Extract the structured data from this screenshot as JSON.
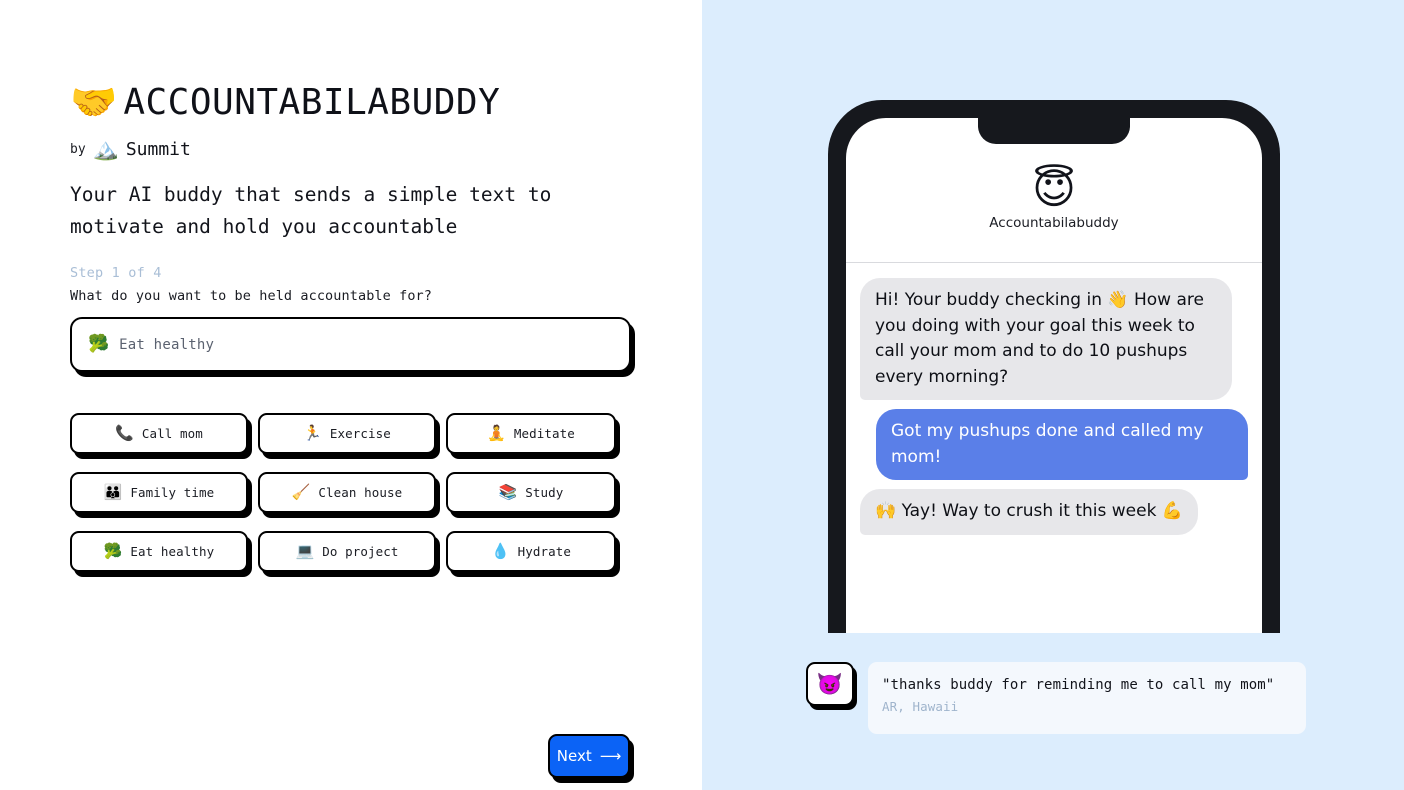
{
  "brand": {
    "logo_icon": "handshake-emoji",
    "logo_glyph": "🤝",
    "title": "ACCOUNTABILABUDDY",
    "by_prefix": "by",
    "maker_icon": "snow-capped-mountain-emoji",
    "maker_glyph": "🏔️",
    "maker_name": "Summit",
    "tagline": "Your AI buddy that sends a simple text to motivate and hold you accountable"
  },
  "wizard": {
    "step_label": "Step 1 of 4",
    "question": "What do you want to be held accountable for?",
    "input": {
      "icon": "broccoli-emoji",
      "icon_glyph": "🥦",
      "value": "Eat healthy"
    },
    "next_button": {
      "label": "Next",
      "arrow_glyph": "⟶",
      "color": "#0b63f6"
    }
  },
  "suggestions": [
    {
      "icon": "telephone-emoji",
      "glyph": "📞",
      "label": "Call mom"
    },
    {
      "icon": "runner-emoji",
      "glyph": "🏃",
      "label": "Exercise"
    },
    {
      "icon": "meditating-person-emoji",
      "glyph": "🧘",
      "label": "Meditate"
    },
    {
      "icon": "family-emoji",
      "glyph": "👪",
      "label": "Family time"
    },
    {
      "icon": "broom-emoji",
      "glyph": "🧹",
      "label": "Clean house"
    },
    {
      "icon": "books-emoji",
      "glyph": "📚",
      "label": "Study"
    },
    {
      "icon": "broccoli-emoji",
      "glyph": "🥦",
      "label": "Eat healthy"
    },
    {
      "icon": "laptop-emoji",
      "glyph": "💻",
      "label": "Do project"
    },
    {
      "icon": "droplet-emoji",
      "glyph": "💧",
      "label": "Hydrate"
    }
  ],
  "preview": {
    "background_color": "#dcedfd",
    "chat": {
      "avatar_icon": "smiling-face-with-halo-emoji",
      "avatar_glyph": "😇",
      "contact_name": "Accountabilabuddy",
      "messages": [
        {
          "from": "buddy",
          "text": "Hi! Your buddy checking in 👋 How are you doing with your goal this week to call your mom and to do 10 pushups every morning?"
        },
        {
          "from": "user",
          "text": "Got my pushups done and called my mom!"
        },
        {
          "from": "buddy",
          "text": "🙌 Yay!  Way to crush it this week 💪"
        }
      ],
      "bubble_in_color": "#e7e7ea",
      "bubble_out_color": "#5a7fe8"
    },
    "testimonial": {
      "avatar_icon": "smiling-face-with-horns-emoji",
      "avatar_glyph": "😈",
      "quote": "\"thanks buddy for reminding me to call my mom\"",
      "author": "AR, Hawaii"
    }
  }
}
